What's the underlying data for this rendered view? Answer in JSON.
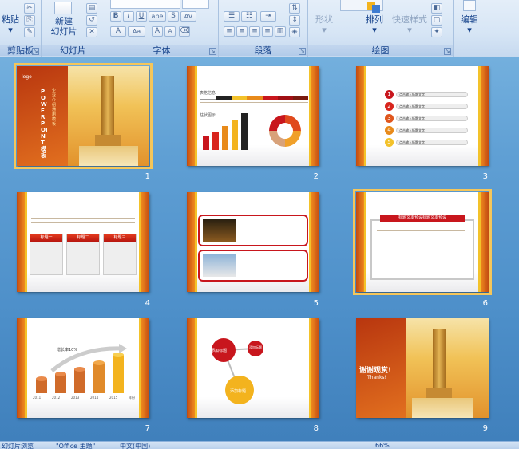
{
  "ribbon": {
    "groups": [
      {
        "label": "剪贴板",
        "button": "粘贴"
      },
      {
        "label": "幻灯片",
        "button_line1": "新建",
        "button_line2": "幻灯片"
      },
      {
        "label": "字体"
      },
      {
        "label": "段落"
      },
      {
        "label": "绘图",
        "shape_label": "形状",
        "arrange_label": "排列",
        "quickstyle_label": "快速样式"
      },
      {
        "label": "",
        "edit_label": "编辑"
      }
    ],
    "font_buttons": [
      "B",
      "I",
      "U",
      "abe",
      "S",
      "AV",
      "A",
      "Aa",
      "A",
      "A"
    ]
  },
  "slides": [
    {
      "num": "1",
      "title_vertical": "POWERPOINT模板",
      "subtitle": "企业介绍通用模板",
      "logo": "logo"
    },
    {
      "num": "2",
      "heading1": "表格信息",
      "heading2": "柱状图示",
      "bar_heights": [
        0.35,
        0.45,
        0.6,
        0.75,
        0.9
      ]
    },
    {
      "num": "3",
      "items": [
        "点击输入标题文字",
        "点击输入标题文字",
        "点击输入标题文字",
        "点击输入标题文字",
        "点击输入标题文字"
      ],
      "numbers": [
        "1",
        "2",
        "3",
        "4",
        "5"
      ]
    },
    {
      "num": "4",
      "tabs": [
        "标题一",
        "标题二",
        "标题三"
      ]
    },
    {
      "num": "5"
    },
    {
      "num": "6",
      "banner": "标题文本预设标题文本预设"
    },
    {
      "num": "7",
      "growth": "增长率10%",
      "years": [
        "2011",
        "2012",
        "2013",
        "2014",
        "2015"
      ],
      "axis_end": "年份"
    },
    {
      "num": "8",
      "bubbles": [
        "添加标题",
        "添加标题",
        "添加标题"
      ]
    },
    {
      "num": "9",
      "thanks": "谢谢观赏!",
      "thanks_en": "Thanks!"
    }
  ],
  "slide1_caption": "",
  "status": {
    "left": "幻灯片浏览",
    "theme": "\"Office 主题\"",
    "lang": "中文(中国)",
    "zoom": "66%"
  }
}
